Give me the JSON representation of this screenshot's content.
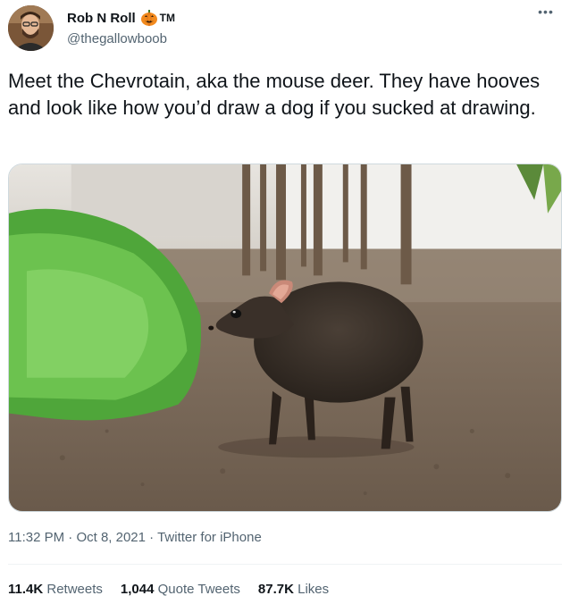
{
  "user": {
    "display_name": "Rob N Roll",
    "badge_text": "TM",
    "handle": "@thegallowboob",
    "avatar_icon": "avatar-image",
    "badge_icon": "jack-o-lantern-emoji"
  },
  "menu": {
    "more_label": "•••"
  },
  "tweet": {
    "text": "Meet the Chevrotain, aka the mouse deer. They have hooves and look like how you’d draw a dog if you sucked at drawing.",
    "media_description_icon": "photo-image"
  },
  "meta": {
    "time": "11:32 PM",
    "sep1": " · ",
    "date": "Oct 8, 2021",
    "sep2": " · ",
    "source": "Twitter for iPhone"
  },
  "stats": {
    "retweets_count": "11.4K",
    "retweets_label": "Retweets",
    "quotes_count": "1,044",
    "quotes_label": "Quote Tweets",
    "likes_count": "87.7K",
    "likes_label": "Likes"
  },
  "colors": {
    "text_primary": "#0f1419",
    "text_secondary": "#536471",
    "border": "#cfd9de",
    "divider": "#eff3f4"
  }
}
